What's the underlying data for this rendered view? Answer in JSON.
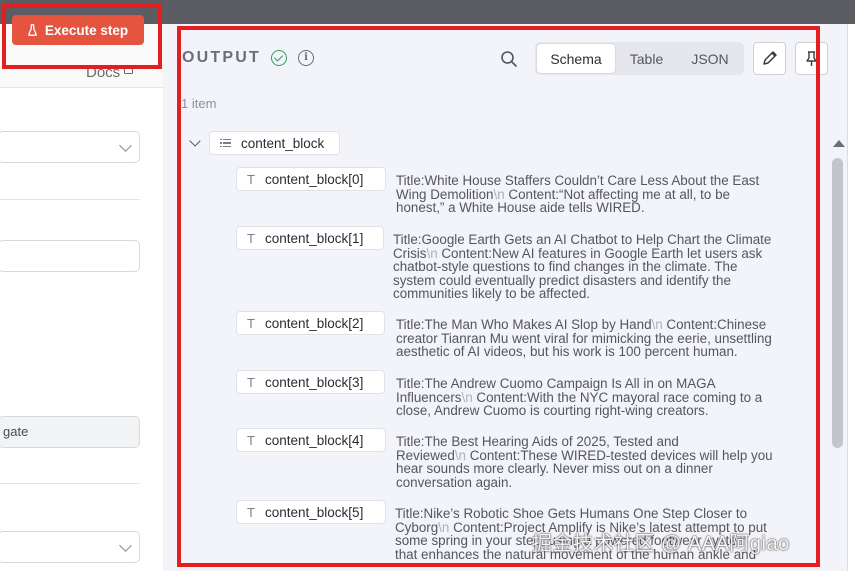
{
  "left_panel": {
    "execute_button": "Execute step",
    "docs_link": "Docs",
    "gate_field": "gate"
  },
  "output": {
    "title": "OUTPUT",
    "item_count": "1 item",
    "view_tabs": [
      "Schema",
      "Table",
      "JSON"
    ],
    "active_tab": "Schema",
    "root_key": "content_block",
    "entries": [
      {
        "key": "content_block[0]",
        "lines": [
          [
            {
              "t": "Title:White House Staffers Couldn’t Care Less About the East"
            }
          ],
          [
            {
              "t": "Wing Demolition"
            },
            {
              "nl": "\\n"
            },
            {
              "t": " Content:“Not affecting me at all, to be"
            }
          ],
          [
            {
              "t": "honest,” a White House aide tells WIRED."
            }
          ]
        ]
      },
      {
        "key": "content_block[1]",
        "lines": [
          [
            {
              "t": "Title:Google Earth Gets an AI Chatbot to Help Chart the Climate"
            }
          ],
          [
            {
              "t": "Crisis"
            },
            {
              "nl": "\\n"
            },
            {
              "t": " Content:New AI features in Google Earth let users ask"
            }
          ],
          [
            {
              "t": "chatbot-style questions to find changes in the climate. The"
            }
          ],
          [
            {
              "t": "system could eventually predict disasters and identify the"
            }
          ],
          [
            {
              "t": "communities likely to be affected."
            }
          ]
        ]
      },
      {
        "key": "content_block[2]",
        "lines": [
          [
            {
              "t": "Title:The Man Who Makes AI Slop by Hand"
            },
            {
              "nl": "\\n"
            },
            {
              "t": " Content:Chinese"
            }
          ],
          [
            {
              "t": "creator Tianran Mu went viral for mimicking the eerie, unsettling"
            }
          ],
          [
            {
              "t": "aesthetic of AI videos, but his work is 100 percent human."
            }
          ]
        ]
      },
      {
        "key": "content_block[3]",
        "lines": [
          [
            {
              "t": "Title:The Andrew Cuomo Campaign Is All in on MAGA"
            }
          ],
          [
            {
              "t": "Influencers"
            },
            {
              "nl": "\\n"
            },
            {
              "t": " Content:With the NYC mayoral race coming to a"
            }
          ],
          [
            {
              "t": "close, Andrew Cuomo is courting right-wing creators."
            }
          ]
        ]
      },
      {
        "key": "content_block[4]",
        "lines": [
          [
            {
              "t": "Title:The Best Hearing Aids of 2025, Tested and"
            }
          ],
          [
            {
              "t": "Reviewed"
            },
            {
              "nl": "\\n"
            },
            {
              "t": " Content:These WIRED-tested devices will help you"
            }
          ],
          [
            {
              "t": "hear sounds more clearly. Never miss out on a dinner"
            }
          ],
          [
            {
              "t": "conversation again."
            }
          ]
        ]
      },
      {
        "key": "content_block[5]",
        "lines": [
          [
            {
              "t": "Title:Nike’s Robotic Shoe Gets Humans One Step Closer to"
            }
          ],
          [
            {
              "t": "Cyborg"
            },
            {
              "nl": "\\n"
            },
            {
              "t": " Content:Project Amplify is Nike’s latest attempt to put"
            }
          ],
          [
            {
              "t": "some spring in your step, using a powered footwear system"
            }
          ],
          [
            {
              "t": "that enhances the natural movement of the human ankle and"
            }
          ]
        ]
      }
    ]
  },
  "watermark": "掘金技术社区 @ AAA阿giao",
  "colors": {
    "execute_bg": "#e5543f",
    "highlight_box": "#e41e1e",
    "success": "#2f9e59"
  }
}
